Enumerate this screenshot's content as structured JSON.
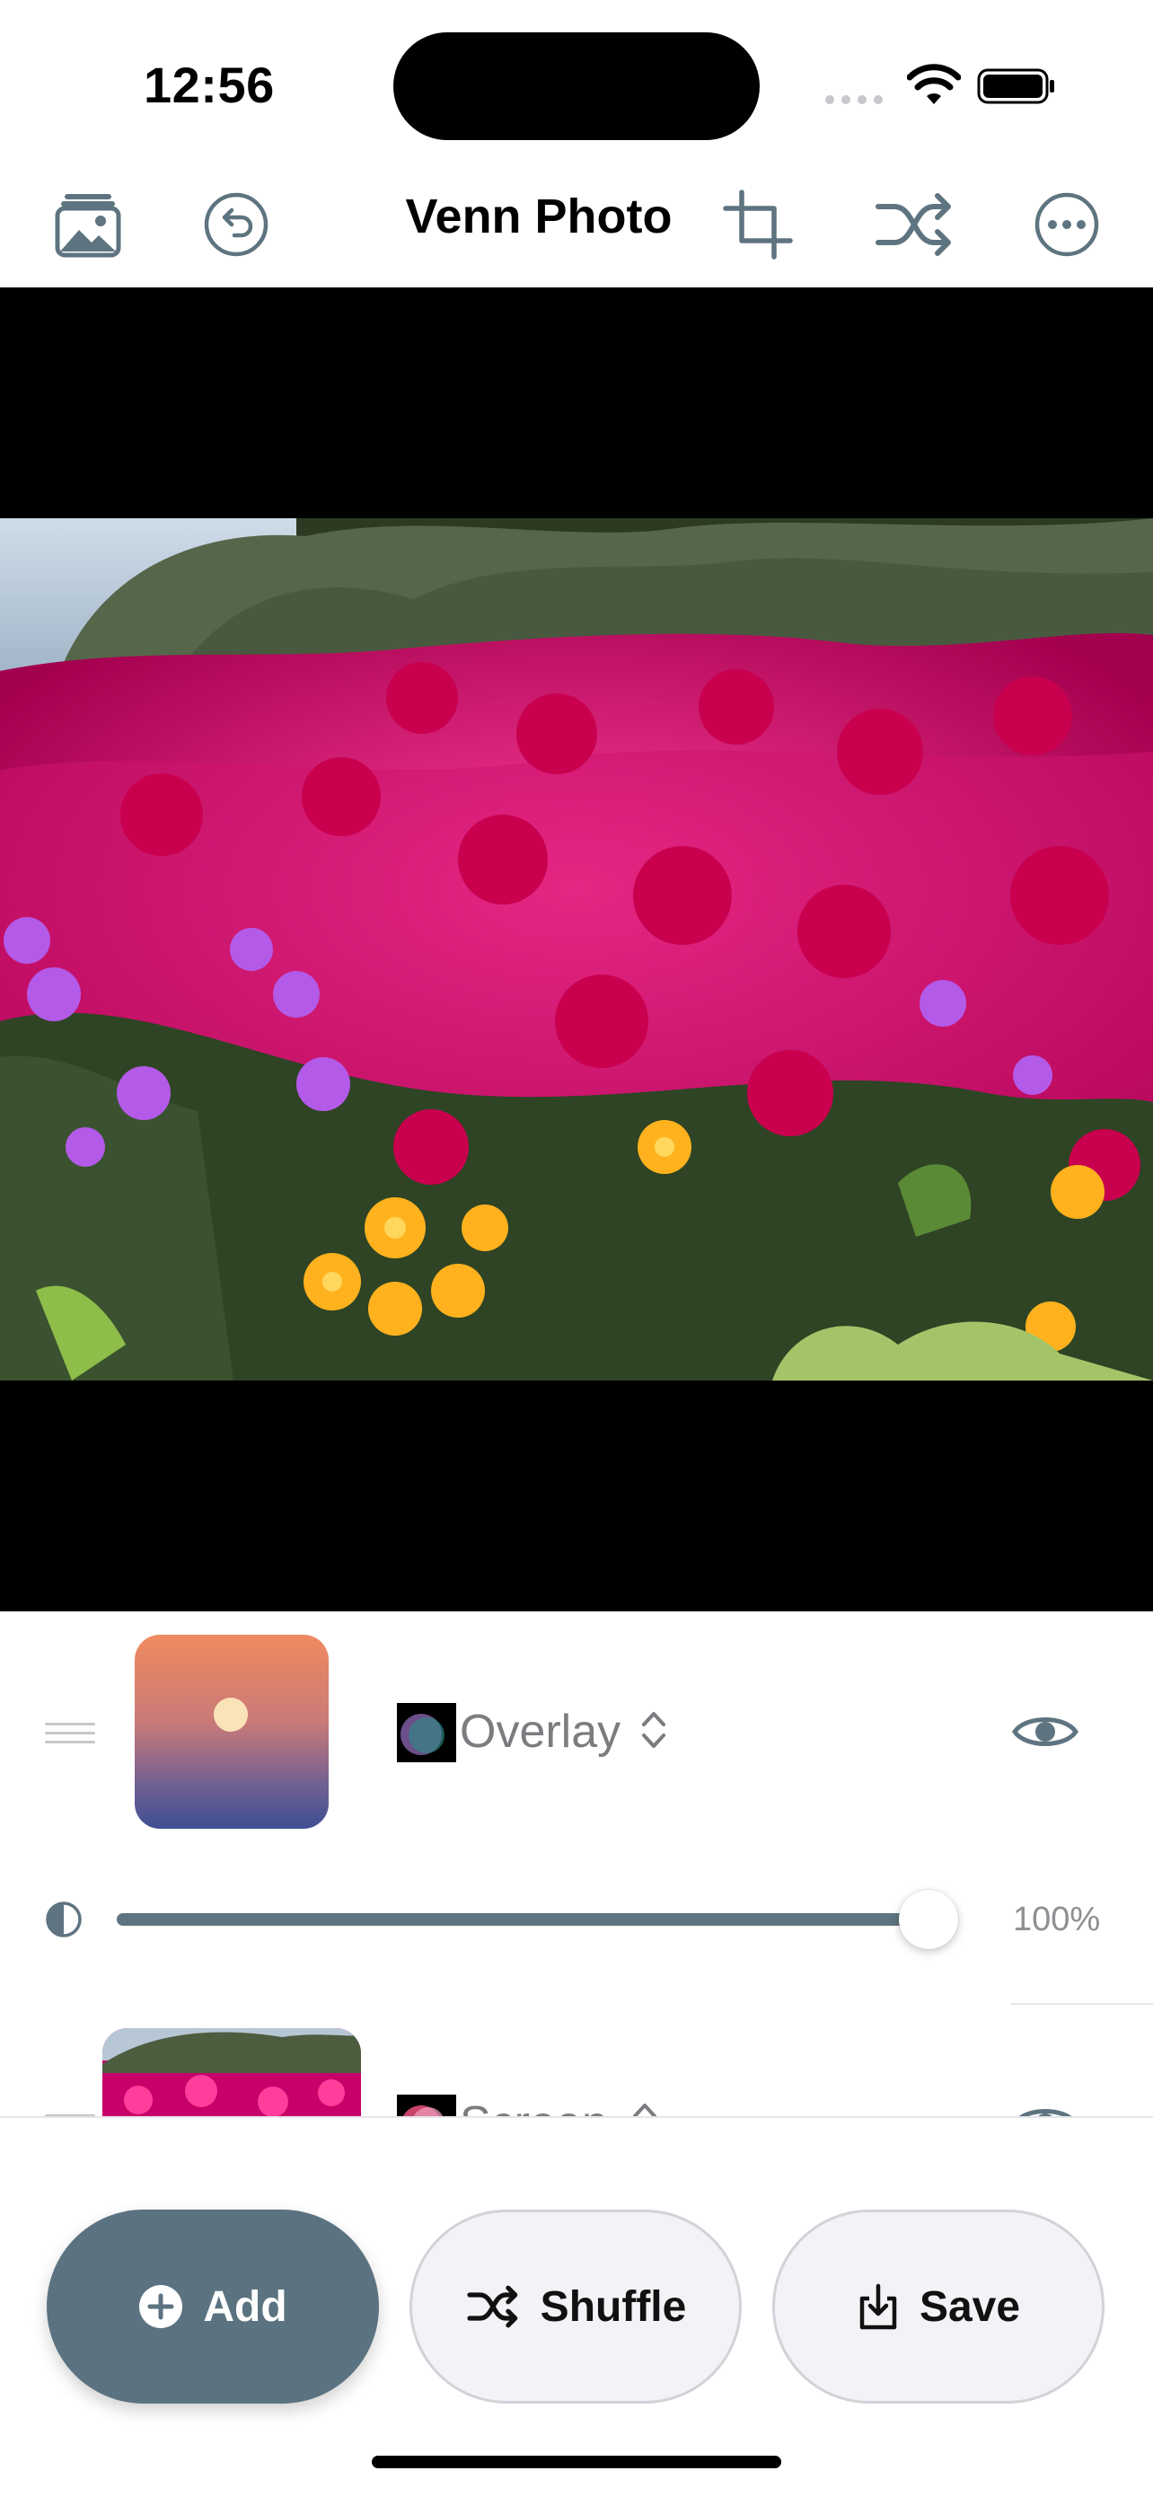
{
  "status_bar": {
    "time": "12:56"
  },
  "nav": {
    "title": "Venn Photo"
  },
  "layers": [
    {
      "blend_mode": "Overlay",
      "visible": true,
      "opacity_label": "100%",
      "opacity": 1.0
    },
    {
      "blend_mode": "Screen",
      "visible": true
    }
  ],
  "toolbar": {
    "add_label": "Add",
    "shuffle_label": "Shuffle",
    "save_label": "Save"
  },
  "colors": {
    "accent": "#5b7280",
    "slider_fill": "#5e7480",
    "canvas_bg": "#000000"
  }
}
